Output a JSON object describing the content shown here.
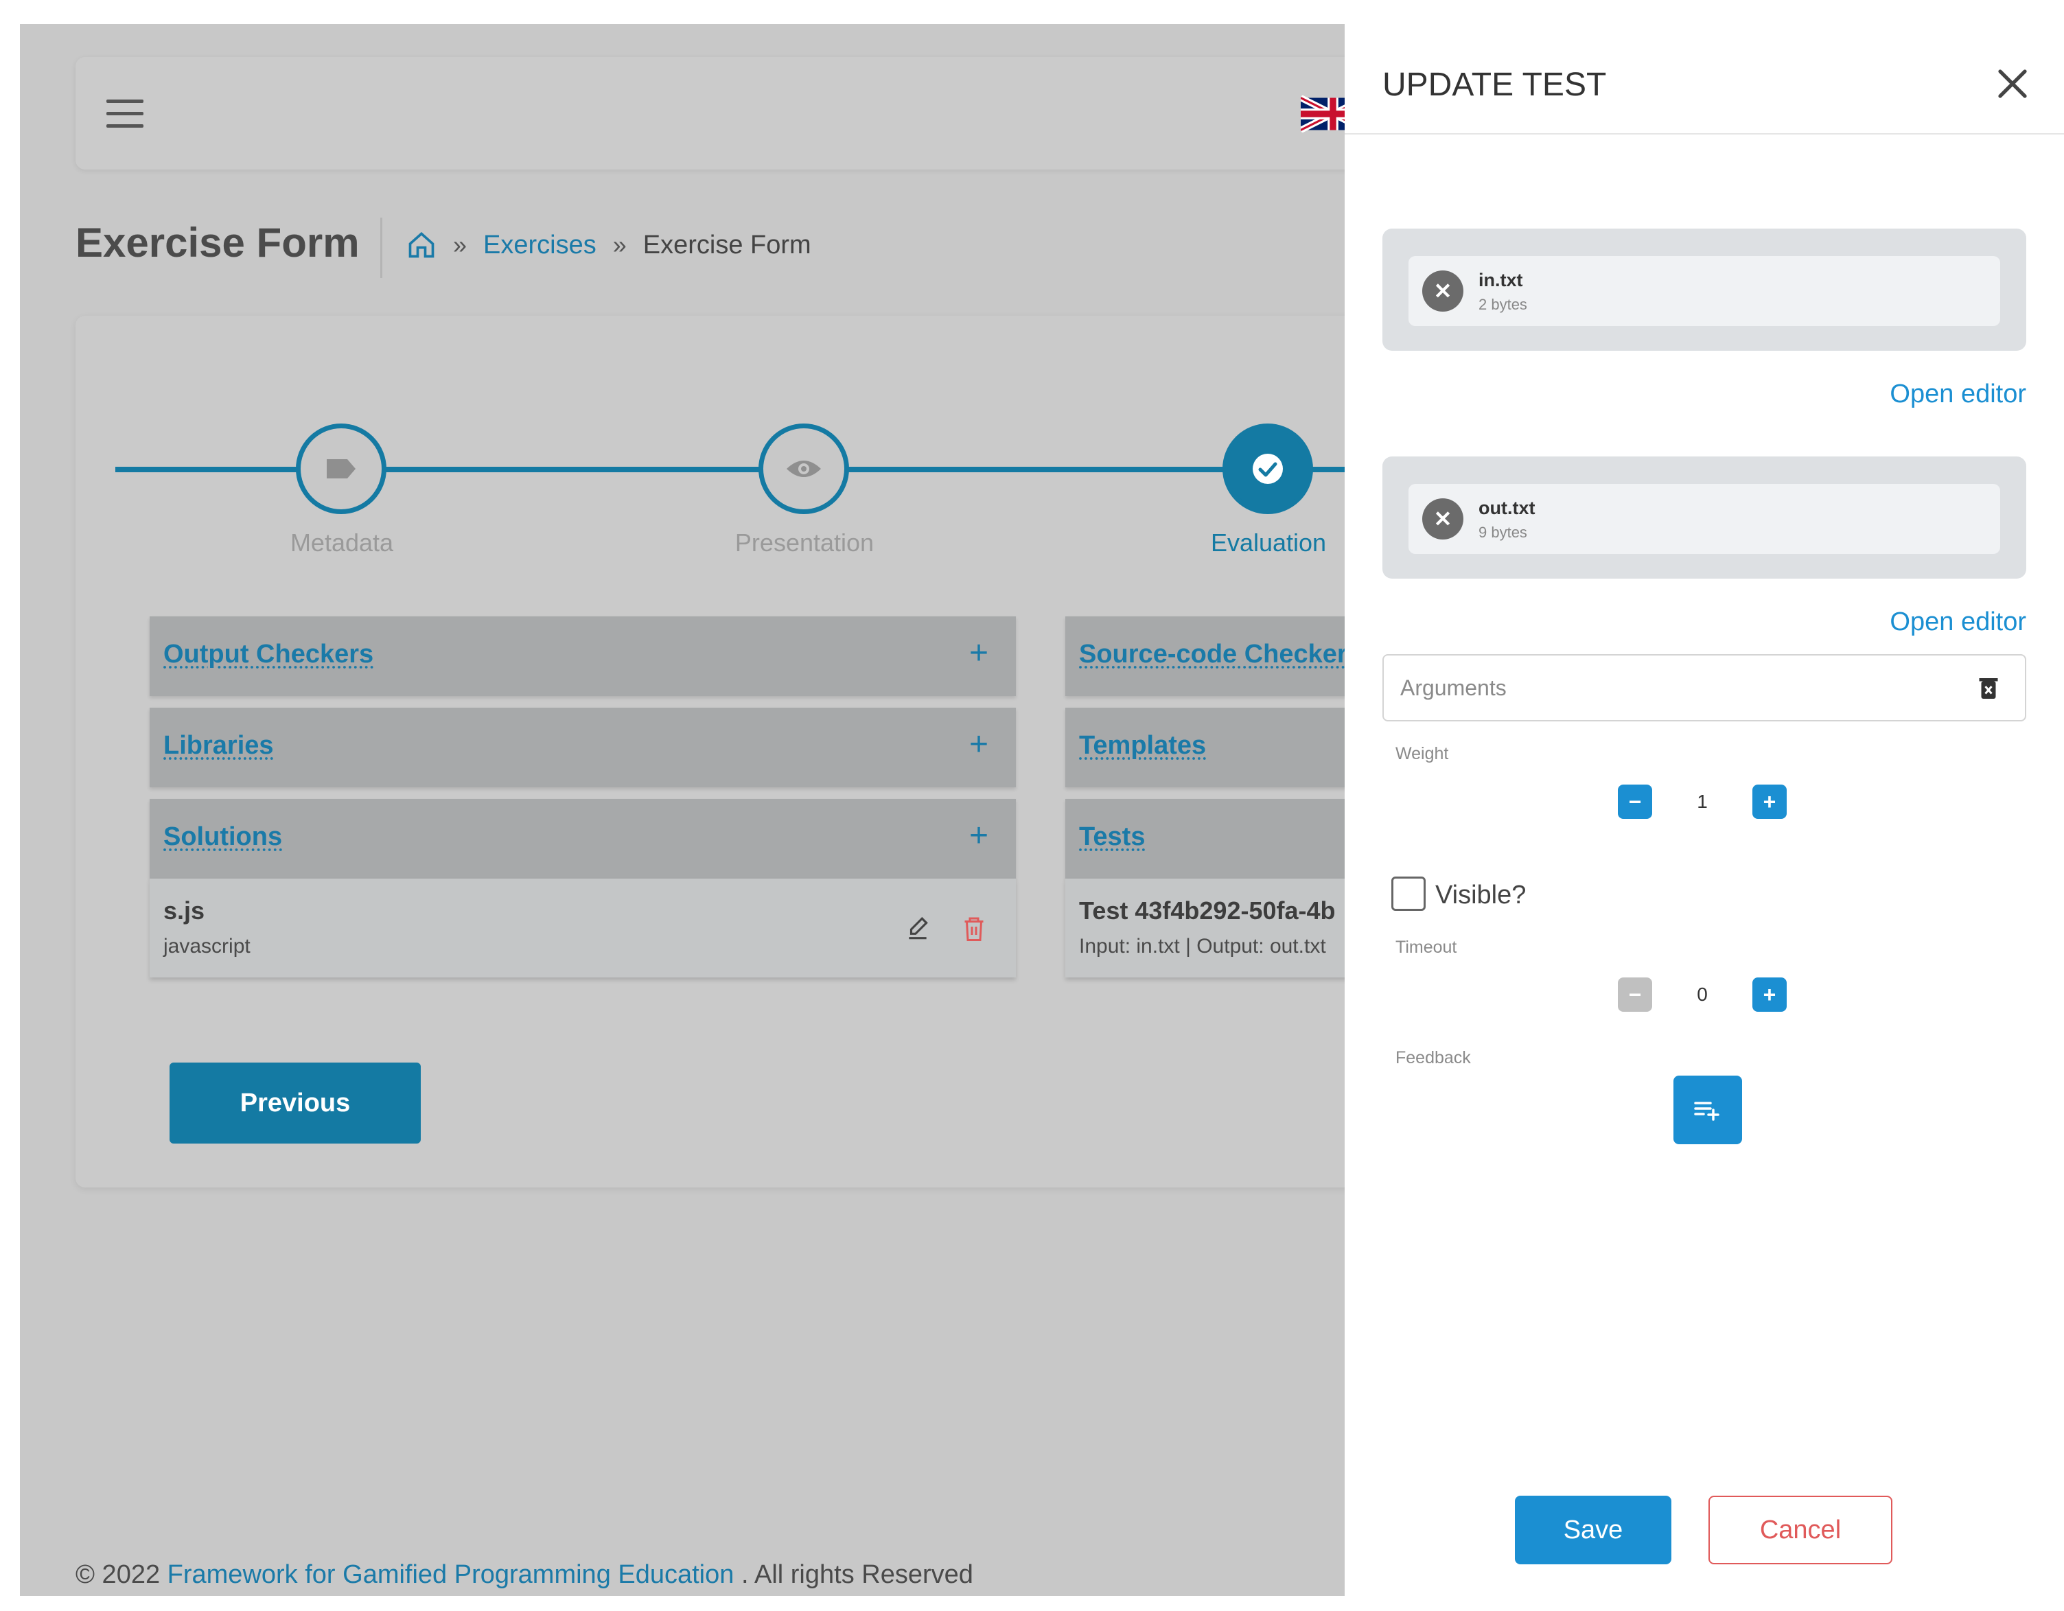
{
  "header": {
    "menu_icon": "hamburger-menu-icon",
    "language_flag": "uk-flag-icon"
  },
  "page": {
    "title": "Exercise Form",
    "breadcrumb": {
      "home_icon": "home-icon",
      "separator": "»",
      "link": "Exercises",
      "current": "Exercise Form"
    }
  },
  "stepper": {
    "steps": [
      {
        "label": "Metadata",
        "icon": "tag-icon",
        "active": false
      },
      {
        "label": "Presentation",
        "icon": "eye-icon",
        "active": false
      },
      {
        "label": "Evaluation",
        "icon": "check-icon",
        "active": true
      }
    ]
  },
  "panels": {
    "add_symbol": "+",
    "output_checkers": {
      "title": "Output Checkers"
    },
    "libraries": {
      "title": "Libraries"
    },
    "solutions": {
      "title": "Solutions",
      "items": [
        {
          "name": "s.js",
          "language": "javascript"
        }
      ]
    },
    "source_code_checkers": {
      "title": "Source-code Checkers"
    },
    "templates": {
      "title": "Templates"
    },
    "tests": {
      "title": "Tests",
      "items": [
        {
          "name": "Test 43f4b292-50fa-4b",
          "detail": "Input: in.txt | Output: out.txt"
        }
      ]
    }
  },
  "buttons": {
    "previous": "Previous"
  },
  "footer": {
    "prefix": "© 2022",
    "link": "Framework for Gamified Programming Education",
    "suffix": ". All rights Reserved"
  },
  "drawer": {
    "title": "UPDATE TEST",
    "input_file": {
      "name": "in.txt",
      "size": "2 bytes"
    },
    "output_file": {
      "name": "out.txt",
      "size": "9 bytes"
    },
    "remove_symbol": "✕",
    "open_editor": "Open editor",
    "arguments": {
      "placeholder": "Arguments",
      "value": ""
    },
    "weight": {
      "label": "Weight",
      "value": "1"
    },
    "visible": {
      "label": "Visible?",
      "checked": false
    },
    "timeout": {
      "label": "Timeout",
      "value": "0"
    },
    "feedback": {
      "label": "Feedback"
    },
    "stepper_minus": "−",
    "stepper_plus": "+",
    "save": "Save",
    "cancel": "Cancel"
  },
  "colors": {
    "primary": "#147aa3",
    "accent": "#1b8fd2",
    "danger": "#e05a5a",
    "overlay": "#c8c8c8"
  }
}
